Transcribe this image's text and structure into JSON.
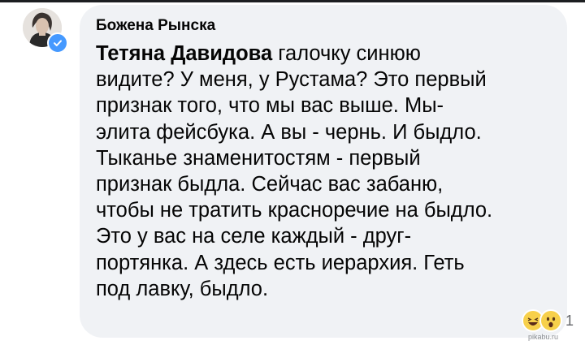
{
  "comment": {
    "author": "Божена Рынска",
    "mention": "Тетяна Давидова",
    "text": " галочку синюю видите? У меня, у Рустама? Это первый признак того, что мы вас выше. Мы- элита фейсбука. А вы - чернь. И быдло. Тыканье знаменитостям - первый признак быдла. Сейчас вас забаню, чтобы не тратить красноречие на быдло. Это у вас на селе каждый - друг-портянка. А здесь есть иерархия. Геть под лавку, быдло.",
    "reaction_count": "1",
    "reactions": [
      "haha-icon",
      "wow-icon"
    ]
  },
  "watermark": "pikabu.ru",
  "colors": {
    "bubble": "#f0f2f5",
    "verified": "#4599ff",
    "emoji": "#f7d04b"
  }
}
